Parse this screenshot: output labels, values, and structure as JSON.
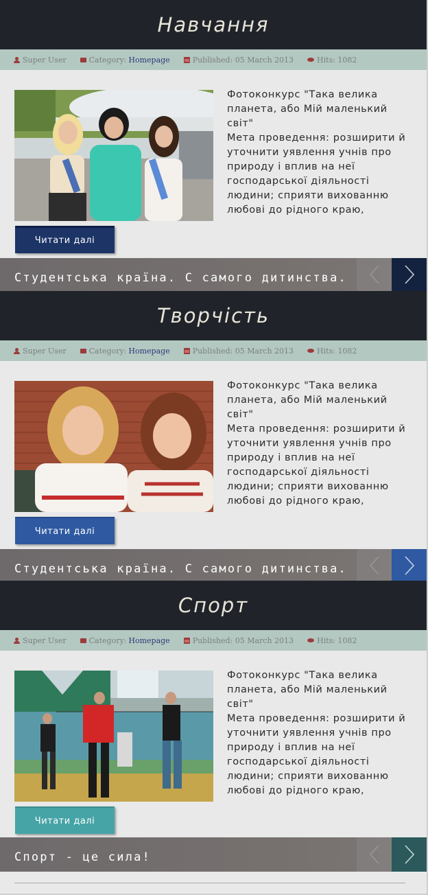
{
  "colors": {
    "header_bg": "#20242a",
    "meta_bg": "#b3c8c1",
    "meta_link": "#2a3a78",
    "slider_bg": "#77716f",
    "btn_dark": "#1c3466",
    "btn_blue": "#2f5aa2",
    "btn_teal": "#46a4a6"
  },
  "sections": [
    {
      "title": "Навчання",
      "meta": {
        "author": "Super User",
        "category_label": "Category:",
        "category_link": "Homepage",
        "published": "Published: 05 March 2013",
        "hits": "Hits: 1082"
      },
      "intro": "Фотоконкурс \"Така велика планета, або Мій маленький світ\"\nМета проведення: розширити й уточнити уявлення учнів про природу і вплив на неї господарської діяльності людини; сприяти вихованню любові до рідного краю,",
      "read_more": "Читати далі",
      "slider_text": "Студентська країна. С самого дитинства.",
      "next_color": "#13223f",
      "photo_icon": "photo-students-airport"
    },
    {
      "title": "Творчість",
      "meta": {
        "author": "Super User",
        "category_label": "Category:",
        "category_link": "Homepage",
        "published": "Published: 05 March 2013",
        "hits": "Hits: 1082"
      },
      "intro": "Фотоконкурс \"Така велика планета, або Мій маленький світ\"\nМета проведення: розширити й уточнити уявлення учнів про природу і вплив на неї господарської діяльності людини; сприяти вихованню любові до рідного краю,",
      "read_more": "Читати далі",
      "slider_text": "Студентська країна. С самого дитинства.",
      "next_color": "#2f5aa2",
      "photo_icon": "photo-two-girls-embroidered"
    },
    {
      "title": "Спорт",
      "meta": {
        "author": "Super User",
        "category_label": "Category:",
        "category_link": "Homepage",
        "published": "Published: 05 March 2013",
        "hits": "Hits: 1082"
      },
      "intro": "Фотоконкурс \"Така велика планета, або Мій маленький світ\"\nМета проведення: розширити й уточнити уявлення учнів про природу і вплив на неї господарської діяльності людини; сприяти вихованню любові до рідного краю,",
      "read_more": "Читати далі",
      "slider_text": "Спорт - це сила!",
      "next_color": "#2c5a5c",
      "photo_icon": "photo-volleyball-gym"
    }
  ]
}
